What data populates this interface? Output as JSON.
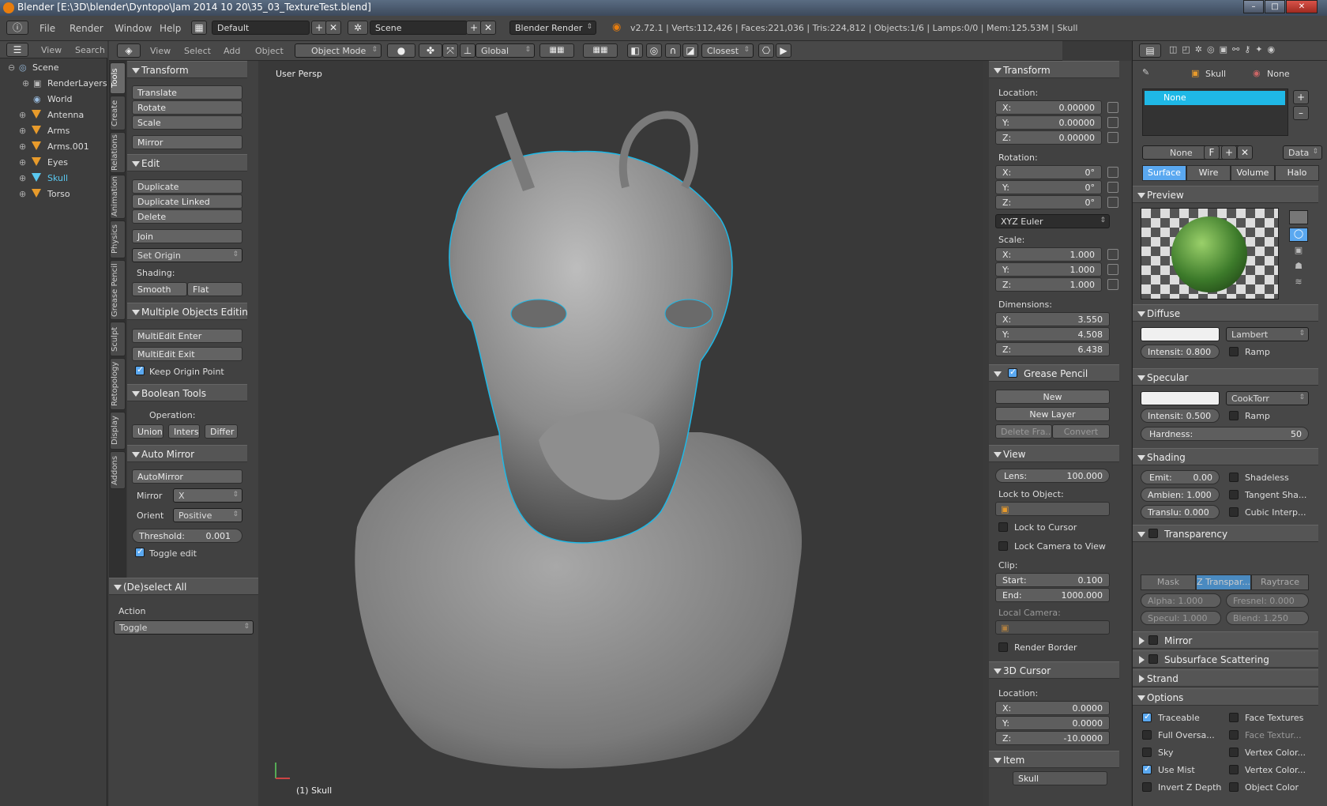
{
  "title": "Blender [E:\\3D\\blender\\Dyntopo\\Jam 2014 10 20\\35_03_TextureTest.blend]",
  "info": {
    "menus": [
      "File",
      "Render",
      "Window",
      "Help"
    ],
    "layout": "Default",
    "scene": "Scene",
    "engine": "Blender Render",
    "stats": "v2.72.1 | Verts:112,426 | Faces:221,036 | Tris:224,812 | Objects:1/6 | Lamps:0/0 | Mem:125.53M | Skull"
  },
  "outliner": {
    "menus": [
      "View",
      "Search"
    ],
    "items": [
      "Scene",
      "RenderLayers",
      "World",
      "Antenna",
      "Arms",
      "Arms.001",
      "Eyes",
      "Skull",
      "Torso"
    ]
  },
  "tool_tabs": [
    "Tools",
    "Create",
    "Relations",
    "Animation",
    "Physics",
    "Grease Pencil",
    "Sculpt",
    "Retopology",
    "Display",
    "Addons"
  ],
  "tools": {
    "transform": {
      "title": "Transform",
      "buttons": [
        "Translate",
        "Rotate",
        "Scale",
        "Mirror"
      ]
    },
    "edit": {
      "title": "Edit",
      "buttons": [
        "Duplicate",
        "Duplicate Linked",
        "Delete",
        "Join"
      ],
      "origin": "Set Origin",
      "shading_label": "Shading:",
      "smooth": "Smooth",
      "flat": "Flat"
    },
    "multi": {
      "title": "Multiple Objects Editing",
      "enter": "MultiEdit Enter",
      "exit": "MultiEdit Exit",
      "keep": "Keep Origin Point"
    },
    "bool": {
      "title": "Boolean Tools",
      "op_label": "Operation:",
      "union": "Union",
      "inters": "Inters",
      "differ": "Differ"
    },
    "automirror": {
      "title": "Auto Mirror",
      "btn": "AutoMirror",
      "mirror_label": "Mirror",
      "mirror_val": "X",
      "orient_label": "Orient",
      "orient_val": "Positive",
      "threshold": "Threshold:",
      "threshold_val": "0.001",
      "toggle": "Toggle edit"
    },
    "deselect": {
      "title": "(De)select All",
      "action_label": "Action",
      "action_val": "Toggle"
    }
  },
  "view_header": {
    "menus": [
      "View",
      "Select",
      "Add",
      "Object"
    ],
    "mode": "Object Mode",
    "orientation": "Global",
    "snap": "Closest"
  },
  "viewport": {
    "persp": "User Persp",
    "object": "(1) Skull"
  },
  "n_panel": {
    "transform": {
      "title": "Transform",
      "location": "Location:",
      "loc": [
        "0.00000",
        "0.00000",
        "0.00000"
      ],
      "rotation": "Rotation:",
      "rot": [
        "0°",
        "0°",
        "0°"
      ],
      "euler": "XYZ Euler",
      "scale": "Scale:",
      "scl": [
        "1.000",
        "1.000",
        "1.000"
      ],
      "dimensions": "Dimensions:",
      "dim": [
        "3.550",
        "4.508",
        "6.438"
      ],
      "axes": [
        "X:",
        "Y:",
        "Z:"
      ]
    },
    "grease": {
      "title": "Grease Pencil",
      "new": "New",
      "new_layer": "New Layer",
      "delete": "Delete Fra...",
      "convert": "Convert"
    },
    "view": {
      "title": "View",
      "lens_label": "Lens:",
      "lens": "100.000",
      "lock_obj": "Lock to Object:",
      "lock_cursor": "Lock to Cursor",
      "lock_cam": "Lock Camera to View",
      "clip": "Clip:",
      "start_label": "Start:",
      "start": "0.100",
      "end_label": "End:",
      "end": "1000.000",
      "local_cam": "Local Camera:",
      "render_border": "Render Border"
    },
    "cursor": {
      "title": "3D Cursor",
      "location": "Location:",
      "vals": [
        "0.0000",
        "0.0000",
        "-10.0000"
      ]
    },
    "item": {
      "title": "Item",
      "name": "Skull"
    }
  },
  "props": {
    "object": "Skull",
    "material": "None",
    "slot": "None",
    "mat_name": "None",
    "f": "F",
    "data": "Data",
    "tabs": [
      "Surface",
      "Wire",
      "Volume",
      "Halo"
    ],
    "preview": "Preview",
    "diffuse": {
      "title": "Diffuse",
      "shader": "Lambert",
      "intensity": "Intensit: 0.800",
      "ramp": "Ramp"
    },
    "specular": {
      "title": "Specular",
      "shader": "CookTorr",
      "intensity": "Intensit: 0.500",
      "ramp": "Ramp",
      "hardness_label": "Hardness:",
      "hardness": "50"
    },
    "shading": {
      "title": "Shading",
      "emit": "Emit:",
      "emit_val": "0.00",
      "ambien": "Ambien: 1.000",
      "translu": "Translu: 0.000",
      "shadeless": "Shadeless",
      "tangent": "Tangent Sha...",
      "cubic": "Cubic Interp..."
    },
    "transparency": {
      "title": "Transparency",
      "mask": "Mask",
      "ztransp": "Z Transpar...",
      "raytrace": "Raytrace",
      "alpha": "Alpha: 1.000",
      "fresnel": "Fresnel: 0.000",
      "specul": "Specul: 1.000",
      "blend": "Blend: 1.250"
    },
    "mirror": "Mirror",
    "sss": "Subsurface Scattering",
    "strand": "Strand",
    "options": {
      "title": "Options",
      "items_left": [
        "Traceable",
        "Full Oversa...",
        "Sky",
        "Use Mist",
        "Invert Z Depth"
      ],
      "items_right": [
        "Face Textures",
        "Face Textur...",
        "Vertex Color...",
        "Vertex Color...",
        "Object Color"
      ]
    }
  },
  "colors": {
    "accent": "#5aa8f0",
    "selection_outline": "#1fb8e6",
    "bg": "#393939"
  }
}
